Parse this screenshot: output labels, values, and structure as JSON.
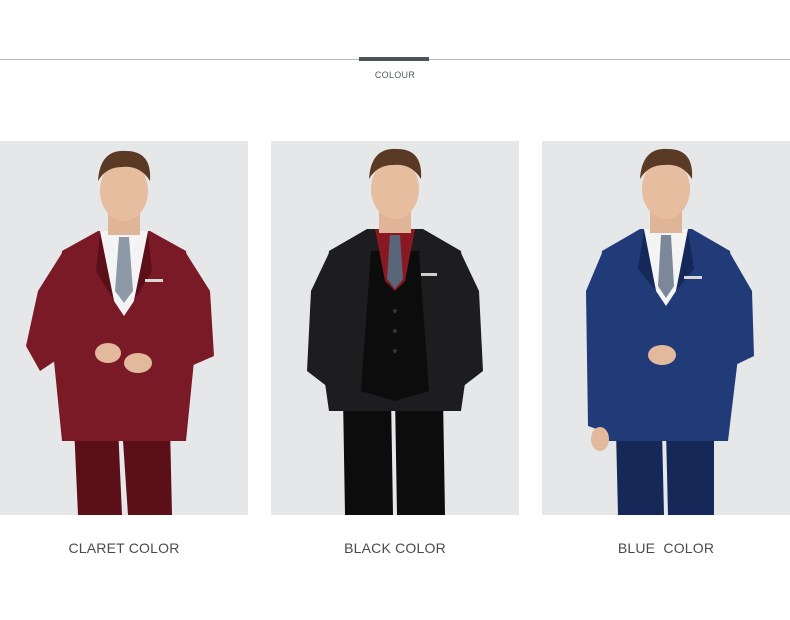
{
  "header": {
    "section_label": "COLOUR"
  },
  "products": [
    {
      "caption": "CLARET COLOR",
      "suit_color": "#7a1a26",
      "suit_shade": "#5a0f19",
      "shirt_color": "#f4f4f4",
      "tie_color": "#8e99a8"
    },
    {
      "caption": "BLACK COLOR",
      "suit_color": "#1d1d1f",
      "suit_shade": "#0c0c0d",
      "shirt_color": "#8a1822",
      "tie_color": "#59667a"
    },
    {
      "caption": "BLUE  COLOR",
      "suit_color": "#213a78",
      "suit_shade": "#152858",
      "shirt_color": "#f4f4f4",
      "tie_color": "#7c889a"
    }
  ]
}
